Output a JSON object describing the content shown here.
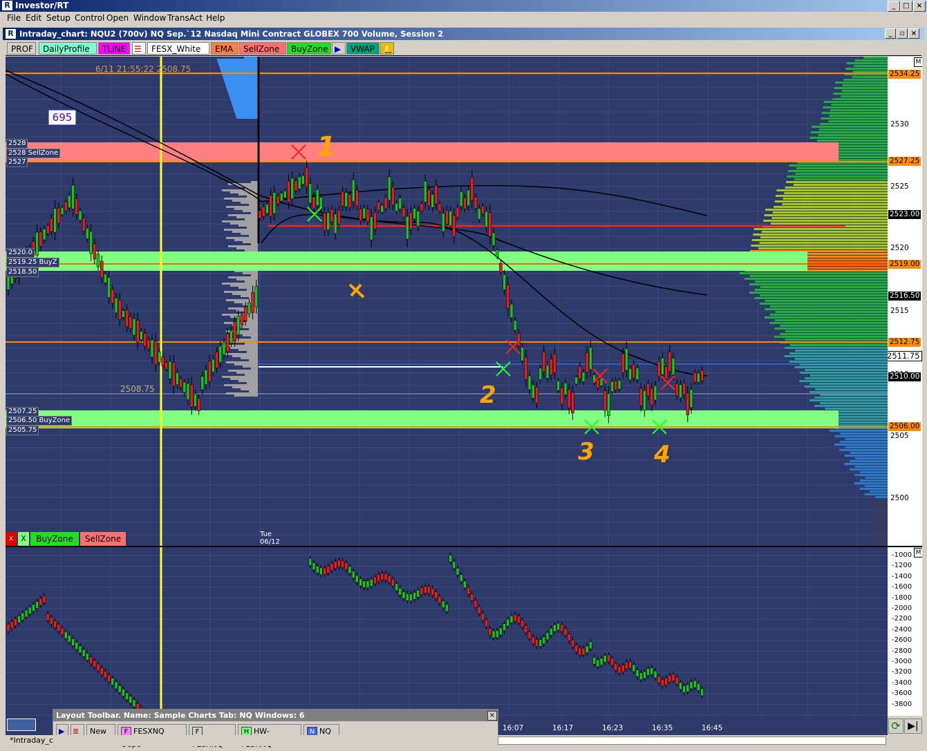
{
  "app": {
    "title": "Investor/RT"
  },
  "menu": [
    "File",
    "Edit",
    "Setup",
    "Control",
    "Open",
    "Window",
    "TransAct",
    "Help"
  ],
  "chart_window": {
    "title": "Intraday_chart: NQU2 (700v) NQ Sep.`12 Nasdaq Mini Contract GLOBEX 700 Volume, Session 2"
  },
  "toolbar": [
    {
      "label": "PROF",
      "bg": "#d4d0c8",
      "fg": "#000"
    },
    {
      "label": "DailyProfile",
      "bg": "#7fffd4",
      "fg": "#000"
    },
    {
      "label": "TLINE",
      "bg": "#ff00ff",
      "fg": "#000"
    },
    {
      "label": "FESX_White",
      "bg": "#ffffff",
      "fg": "#000"
    },
    {
      "label": "EMA",
      "bg": "#ff8040",
      "fg": "#000"
    },
    {
      "label": "SellZone",
      "bg": "#ff7070",
      "fg": "#000"
    },
    {
      "label": "BuyZone",
      "bg": "#22dd22",
      "fg": "#000"
    },
    {
      "label": "VWAP",
      "bg": "#00a080",
      "fg": "#000"
    }
  ],
  "chart": {
    "timestamp_label": "6/11 21:55:22 2508.75",
    "badge": "695",
    "mid_label": "2508.75",
    "session_label_day": "Tue",
    "session_label_date": "06/12",
    "annotations": [
      "1",
      "2",
      "3",
      "4"
    ],
    "left_zone_labels": {
      "sell_top": "2528",
      "sell_mid": "2528 SellZone",
      "sell_bot": "2527",
      "mid_top": "2520.0",
      "mid_mid": "2519.25 BuyZ",
      "mid_bot": "2518.50",
      "buy_top": "2507.25",
      "buy_mid": "2506.50 BuyZone",
      "buy_bot": "2505.75"
    },
    "legend": {
      "x1": "x",
      "x2": "X",
      "buy": "BuyZone",
      "sell": "SellZone"
    }
  },
  "price_scale": {
    "ticks": [
      "2530",
      "2525",
      "2520",
      "2515",
      "2510",
      "2505",
      "2500"
    ],
    "boxes": [
      {
        "label": "2534.25",
        "bg": "#ff8c00"
      },
      {
        "label": "2527.25",
        "bg": "#ff8c00"
      },
      {
        "label": "2523.00",
        "bg": "#000000"
      },
      {
        "label": "2519.00",
        "bg": "#ff8c00"
      },
      {
        "label": "2516.50",
        "bg": "#000000"
      },
      {
        "label": "2512.75",
        "bg": "#ff8c00"
      },
      {
        "label": "2511.75",
        "bg": "#ffffff"
      },
      {
        "label": "2510.00",
        "bg": "#000000"
      },
      {
        "label": "2506.00",
        "bg": "#ff8c00"
      }
    ],
    "m": "M"
  },
  "lower_scale": {
    "ticks": [
      "-1000",
      "-1200",
      "-1400",
      "-1600",
      "-1800",
      "-2000",
      "-2200",
      "-2400",
      "-2600",
      "-2800",
      "-3000",
      "-3200",
      "-3400",
      "-3600",
      "-3800"
    ],
    "m": "M"
  },
  "time_axis": [
    "16:07",
    "16:17",
    "16:23",
    "16:35",
    "16:45"
  ],
  "layout_toolbar": {
    "title": "Layout Toolbar. Name: Sample Charts  Tab: NQ  Windows: 6",
    "buttons": [
      {
        "badge": "",
        "label": "New"
      },
      {
        "badge": "F",
        "label": "FESXNQ Odpo",
        "color": "#ff80ff"
      },
      {
        "badge": "F",
        "label": "FESXNQ",
        "color": "#d4d0c8"
      },
      {
        "badge": "H",
        "label": "HW-FESXNQ",
        "color": "#80ff80"
      },
      {
        "badge": "N",
        "label": "NQ",
        "color": "#4060ff"
      }
    ]
  },
  "status": {
    "tab": "*Intraday_c"
  }
}
